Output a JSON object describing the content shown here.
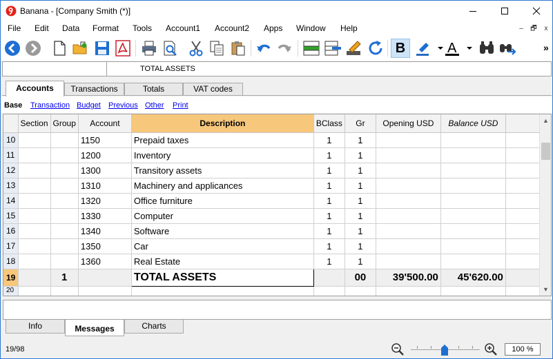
{
  "window": {
    "title": "Banana - [Company Smith (*)]",
    "minimize": "minimize",
    "maximize": "maximize",
    "close": "close"
  },
  "menu": {
    "items": [
      "File",
      "Edit",
      "Data",
      "Format",
      "Tools",
      "Account1",
      "Account2",
      "Apps",
      "Window",
      "Help"
    ],
    "mdi": [
      "–",
      "🗗",
      "x"
    ]
  },
  "toolbar": {
    "icons": [
      "back-icon",
      "forward-icon",
      "new-file-icon",
      "open-folder-icon",
      "save-icon",
      "pdf-icon",
      "print-icon",
      "print-preview-icon",
      "cut-icon",
      "copy-icon",
      "paste-icon",
      "undo-icon",
      "redo-icon",
      "insert-rows-icon",
      "delete-rows-icon",
      "edit-icon",
      "recheck-icon",
      "bold-icon",
      "highlight-icon",
      "font-color-icon",
      "find-icon",
      "find-next-icon"
    ],
    "bold_label": "B",
    "overflow": "»",
    "colors": {
      "accent": "#1e6fd1",
      "pdf_red": "#c8202a",
      "bold_active": "#cde3f7"
    }
  },
  "address": {
    "cell_ref": "",
    "value": "TOTAL ASSETS"
  },
  "tabs": [
    {
      "label": "Accounts",
      "active": true
    },
    {
      "label": "Transactions",
      "active": false
    },
    {
      "label": "Totals",
      "active": false
    },
    {
      "label": "VAT codes",
      "active": false
    }
  ],
  "views": [
    "Base",
    "Transaction",
    "Budget",
    "Previous",
    "Other",
    "Print"
  ],
  "table": {
    "columns": [
      "Section",
      "Group",
      "Account",
      "Description",
      "BClass",
      "Gr",
      "Opening USD",
      "Balance USD"
    ],
    "rows": [
      {
        "n": "10",
        "section": "",
        "group": "",
        "account": "1150",
        "description": "Prepaid taxes",
        "bclass": "1",
        "gr": "1",
        "opening": "",
        "balance": ""
      },
      {
        "n": "11",
        "section": "",
        "group": "",
        "account": "1200",
        "description": "Inventory",
        "bclass": "1",
        "gr": "1",
        "opening": "",
        "balance": ""
      },
      {
        "n": "12",
        "section": "",
        "group": "",
        "account": "1300",
        "description": "Transitory assets",
        "bclass": "1",
        "gr": "1",
        "opening": "",
        "balance": ""
      },
      {
        "n": "13",
        "section": "",
        "group": "",
        "account": "1310",
        "description": "Machinery and applicances",
        "bclass": "1",
        "gr": "1",
        "opening": "",
        "balance": ""
      },
      {
        "n": "14",
        "section": "",
        "group": "",
        "account": "1320",
        "description": "Office furniture",
        "bclass": "1",
        "gr": "1",
        "opening": "",
        "balance": ""
      },
      {
        "n": "15",
        "section": "",
        "group": "",
        "account": "1330",
        "description": "Computer",
        "bclass": "1",
        "gr": "1",
        "opening": "",
        "balance": ""
      },
      {
        "n": "16",
        "section": "",
        "group": "",
        "account": "1340",
        "description": "Software",
        "bclass": "1",
        "gr": "1",
        "opening": "",
        "balance": ""
      },
      {
        "n": "17",
        "section": "",
        "group": "",
        "account": "1350",
        "description": "Car",
        "bclass": "1",
        "gr": "1",
        "opening": "",
        "balance": ""
      },
      {
        "n": "18",
        "section": "",
        "group": "",
        "account": "1360",
        "description": "Real Estate",
        "bclass": "1",
        "gr": "1",
        "opening": "",
        "balance": ""
      }
    ],
    "total_row": {
      "n": "19",
      "section": "",
      "group": "1",
      "account": "",
      "description": "TOTAL ASSETS",
      "bclass": "",
      "gr": "00",
      "opening": "39'500.00",
      "balance": "45'620.00"
    },
    "partial_row": {
      "n": "20"
    }
  },
  "bottom_tabs": [
    {
      "label": "Info",
      "active": false
    },
    {
      "label": "Messages",
      "active": true
    },
    {
      "label": "Charts",
      "active": false
    }
  ],
  "status": {
    "position": "19/98",
    "zoom": "100 %",
    "zoom_level_fraction": 0.5
  }
}
